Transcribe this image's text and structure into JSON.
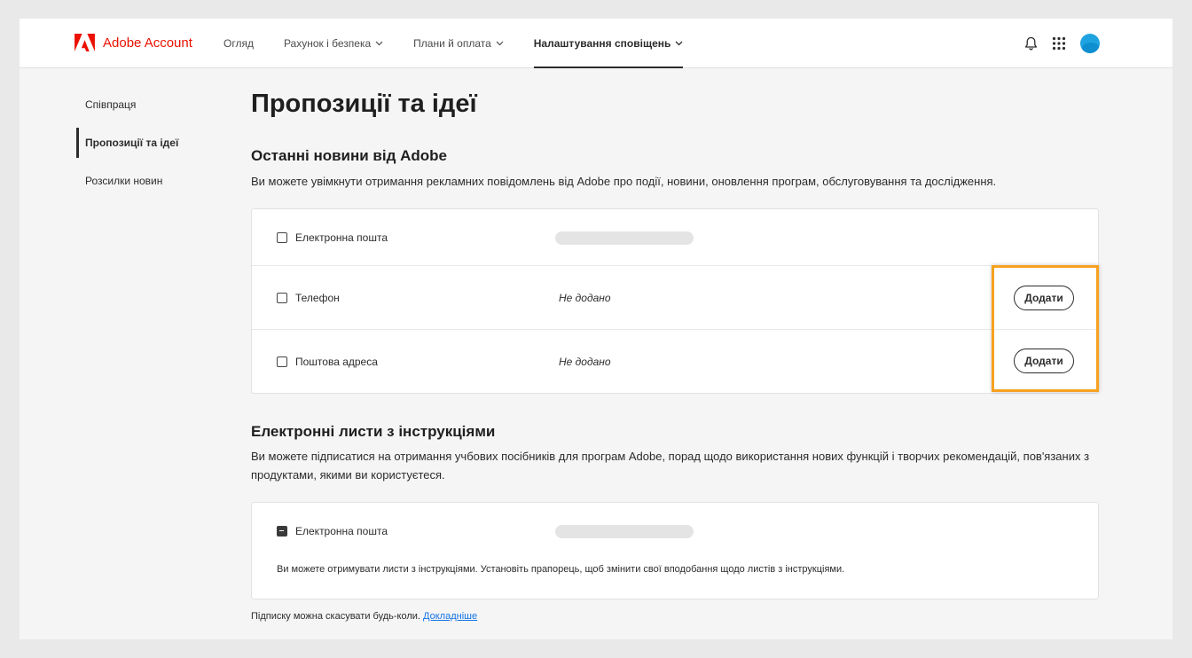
{
  "app": {
    "title": "Adobe Account"
  },
  "nav": {
    "items": [
      {
        "label": "Огляд",
        "dropdown": false,
        "active": false
      },
      {
        "label": "Рахунок і безпека",
        "dropdown": true,
        "active": false
      },
      {
        "label": "Плани й оплата",
        "dropdown": true,
        "active": false
      },
      {
        "label": "Налаштування сповіщень",
        "dropdown": true,
        "active": true
      }
    ]
  },
  "header_icons": [
    "bell-icon",
    "apps-grid-icon",
    "avatar"
  ],
  "sidebar": {
    "items": [
      {
        "label": "Співпраця",
        "active": false
      },
      {
        "label": "Пропозиції та ідеї",
        "active": true
      },
      {
        "label": "Розсилки новин",
        "active": false
      }
    ]
  },
  "page": {
    "title": "Пропозиції та ідеї"
  },
  "news": {
    "title": "Останні новини від Adobe",
    "description": "Ви можете увімкнути отримання рекламних повідомлень від Adobe про події, новини, оновлення програм, обслуговування та дослідження.",
    "rows": [
      {
        "label": "Електронна пошта",
        "checked": false,
        "value": "",
        "button": ""
      },
      {
        "label": "Телефон",
        "checked": false,
        "value": "Не додано",
        "button": "Додати"
      },
      {
        "label": "Поштова адреса",
        "checked": false,
        "value": "Не додано",
        "button": "Додати"
      }
    ]
  },
  "instructions": {
    "title": "Електронні листи з інструкціями",
    "description": "Ви можете підписатися на отримання учбових посібників для програм Adobe, порад щодо використання нових функцій і творчих рекомендацій, пов'язаних з продуктами, якими ви користуєтеся.",
    "row": {
      "label": "Електронна пошта",
      "state": "mixed"
    },
    "note": "Ви можете отримувати листи з інструкціями. Установіть прапорець, щоб змінити свої вподобання щодо листів з інструкціями."
  },
  "footer": {
    "text": "Підписку можна скасувати будь-коли.",
    "link": "Докладніше"
  },
  "colors": {
    "brand": "#eb1000",
    "highlight": "#f7a11f",
    "link": "#1473e6",
    "avatar": "#1fa3e0"
  }
}
